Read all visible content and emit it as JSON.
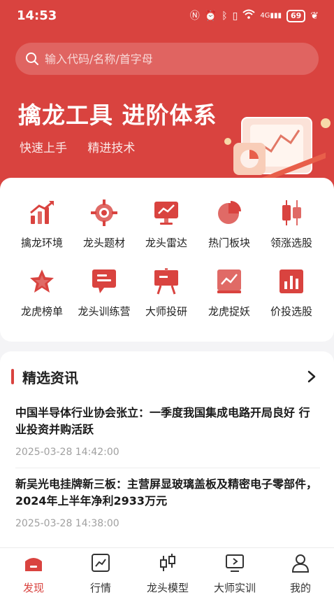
{
  "status_bar": {
    "time": "14:53",
    "battery": "69",
    "network": "4G"
  },
  "search": {
    "placeholder": "输入代码/名称/首字母"
  },
  "hero": {
    "headline": "擒龙工具  进阶体系",
    "subtitle_items": [
      "快速上手",
      "精进技术"
    ]
  },
  "tools": [
    {
      "label": "擒龙环境",
      "icon": "trend-chart-icon"
    },
    {
      "label": "龙头题材",
      "icon": "target-icon"
    },
    {
      "label": "龙头雷达",
      "icon": "monitor-chart-icon"
    },
    {
      "label": "热门板块",
      "icon": "pie-chart-icon"
    },
    {
      "label": "领涨选股",
      "icon": "candlestick-icon"
    },
    {
      "label": "龙虎榜单",
      "icon": "star-ribbon-icon"
    },
    {
      "label": "龙头训练营",
      "icon": "chat-board-icon"
    },
    {
      "label": "大师投研",
      "icon": "easel-icon"
    },
    {
      "label": "龙虎捉妖",
      "icon": "line-chart-board-icon"
    },
    {
      "label": "价投选股",
      "icon": "bar-chart-icon"
    }
  ],
  "news": {
    "section_title": "精选资讯",
    "items": [
      {
        "title": "中国半导体行业协会张立：一季度我国集成电路开局良好 行业投资并购活跃",
        "time": "2025-03-28 14:42:00"
      },
      {
        "title": "新吴光电挂牌新三板：主营屏显玻璃盖板及精密电子零部件，2024年上半年净利2933万元",
        "time": "2025-03-28 14:38:00"
      }
    ]
  },
  "tabbar": {
    "active": "发现",
    "tabs": [
      {
        "label": "发现",
        "icon": "home-icon"
      },
      {
        "label": "行情",
        "icon": "market-chart-icon"
      },
      {
        "label": "龙头模型",
        "icon": "candlestick-model-icon"
      },
      {
        "label": "大师实训",
        "icon": "play-screen-icon"
      },
      {
        "label": "我的",
        "icon": "user-icon"
      }
    ]
  },
  "colors": {
    "brand": "#d9433f",
    "background": "#f4f4f6"
  }
}
